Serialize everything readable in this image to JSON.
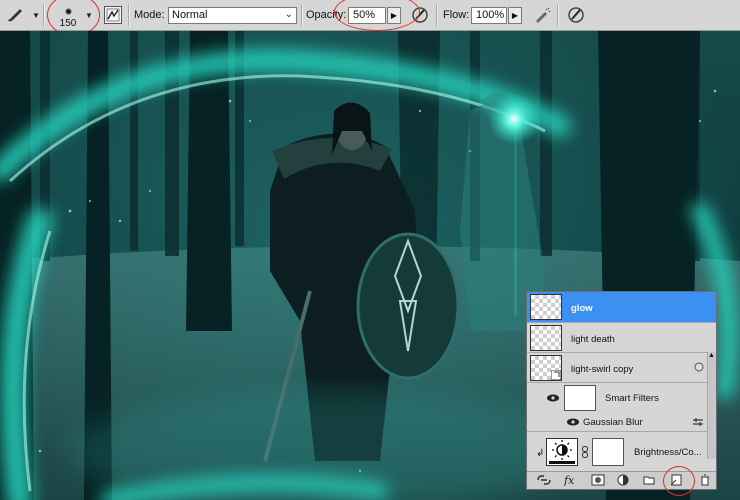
{
  "options_bar": {
    "tool_icon": "brush-icon",
    "brush_size": "150",
    "mode_label": "Mode:",
    "mode_value": "Normal",
    "opacity_label": "Opacity:",
    "opacity_value": "50%",
    "flow_label": "Flow:",
    "flow_value": "100%",
    "icons": [
      "toggle-brush-panel-icon",
      "pen-pressure-opacity-icon",
      "airbrush-icon",
      "pen-pressure-size-icon"
    ]
  },
  "layers_panel": {
    "layers": [
      {
        "name": "glow",
        "selected": true
      },
      {
        "name": "light death"
      },
      {
        "name": "light-swirl copy"
      },
      {
        "name": "Smart Filters"
      },
      {
        "name": "Gaussian Blur"
      },
      {
        "name": "Brightness/Co..."
      }
    ],
    "footer_icons": [
      "link-layers-icon",
      "fx-icon",
      "add-mask-icon",
      "adjustment-layer-icon",
      "new-group-icon",
      "new-layer-icon",
      "trash-icon"
    ]
  },
  "colors": {
    "selection_blue": "#3b90f2",
    "annotation_red": "#e0302c",
    "glow_teal": "#27d6c0"
  }
}
